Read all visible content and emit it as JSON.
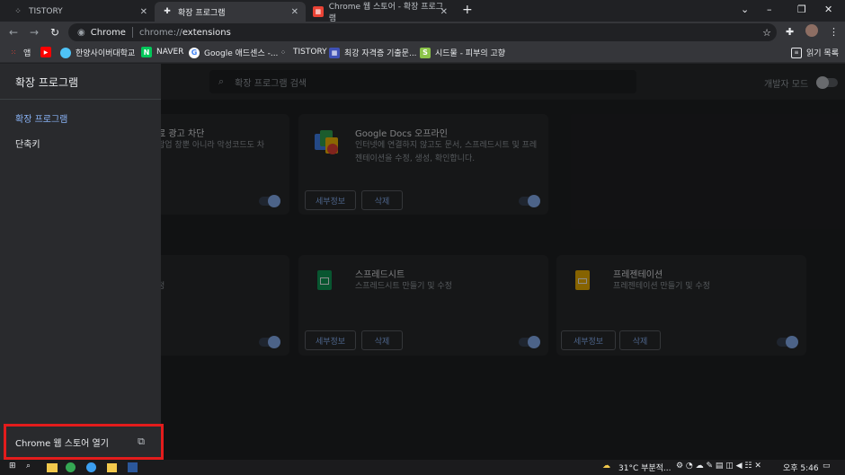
{
  "tabs": [
    {
      "title": "TISTORY",
      "icon": "tistory-icon",
      "active": false
    },
    {
      "title": "확장 프로그램",
      "icon": "puzzle-icon",
      "active": true
    },
    {
      "title": "Chrome 웹 스토어 - 확장 프로그램",
      "icon": "webstore-icon",
      "active": false
    }
  ],
  "omnibox": {
    "site": "Chrome",
    "scheme": "chrome://",
    "path": "extensions"
  },
  "bookmarks": [
    {
      "label": "앱",
      "icon": "apps-grid-icon",
      "color": "#ea4335"
    },
    {
      "label": "",
      "icon": "youtube-icon",
      "color": "#ff0000"
    },
    {
      "label": "한양사이버대학교",
      "icon": "hanyang-icon",
      "color": "#4fc3f7"
    },
    {
      "label": "NAVER",
      "icon": "naver-icon",
      "color": "#03c75a"
    },
    {
      "label": "Google 애드센스 -...",
      "icon": "google-icon",
      "color": "#ffffff"
    },
    {
      "label": "TISTORY",
      "icon": "tistory-icon",
      "color": "#bdc1c6"
    },
    {
      "label": "최강 자격증 기출문...",
      "icon": "cert-icon",
      "color": "#3f51b5"
    },
    {
      "label": "시드물 - 피부의 고향",
      "icon": "sidmool-icon",
      "color": "#8bc34a"
    }
  ],
  "reading_list": "읽기 목록",
  "search": {
    "placeholder": "확장 프로그램 검색"
  },
  "dev_mode": {
    "label": "개발자 모드",
    "enabled": false
  },
  "extensions": [
    {
      "name": "",
      "title_fragment": "료 광고 차단",
      "desc_fragment": "팝업 창뿐 아니라 악성코드도 차",
      "enabled": true
    },
    {
      "name": "Google Docs 오프라인",
      "desc": "인터넷에 연결하지 않고도 문서, 스프레드시트 및 프레젠테이션을 수정, 생성, 확인합니다.",
      "details": "세부정보",
      "remove": "삭제",
      "enabled": true
    },
    {
      "name": "",
      "desc_fragment": "정",
      "enabled": true
    },
    {
      "name": "스프레드시트",
      "desc": "스프레드시트 만들기 및 수정",
      "details": "세부정보",
      "remove": "삭제",
      "enabled": true
    },
    {
      "name": "프레젠테이션",
      "desc": "프레젠테이션 만들기 및 수정",
      "details": "세부정보",
      "remove": "삭제",
      "enabled": true
    }
  ],
  "drawer": {
    "title": "확장 프로그램",
    "items": [
      {
        "label": "확장 프로그램",
        "selected": true
      },
      {
        "label": "단축키",
        "selected": false
      }
    ],
    "store_link": "Chrome 웹 스토어 열기"
  },
  "taskbar": {
    "weather": "31°C  부분적...",
    "time": "오후 5:46"
  }
}
